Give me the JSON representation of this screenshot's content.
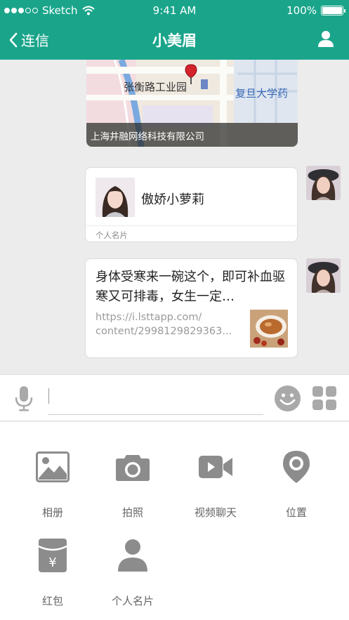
{
  "status_bar": {
    "carrier": "Sketch",
    "time": "9:41 AM",
    "battery": "100%"
  },
  "nav": {
    "back_label": "连信",
    "title": "小美眉"
  },
  "messages": {
    "location": {
      "place_label": "张衡路工业园",
      "nearby_label": "复旦大学药",
      "address": "上海井融网络科技有限公司"
    },
    "contact_card": {
      "name": "傲娇小萝莉",
      "tag": "个人名片"
    },
    "link_card": {
      "text": "身体受寒来一碗这个，即可补血驱寒又可排毒，女生一定…",
      "url_line1": "https://i.lsttapp.com/",
      "url_line2": "content/2998129829363..."
    }
  },
  "input": {
    "placeholder": ""
  },
  "panel": {
    "items": [
      {
        "label": "相册",
        "icon": "photo-album-icon"
      },
      {
        "label": "拍照",
        "icon": "camera-icon"
      },
      {
        "label": "视频聊天",
        "icon": "video-call-icon"
      },
      {
        "label": "位置",
        "icon": "location-pin-icon"
      },
      {
        "label": "红包",
        "icon": "red-packet-icon"
      },
      {
        "label": "个人名片",
        "icon": "contact-card-icon"
      }
    ]
  },
  "colors": {
    "brand": "#1aa58b",
    "background": "#ececec",
    "icon_gray": "#8c8c8c"
  }
}
